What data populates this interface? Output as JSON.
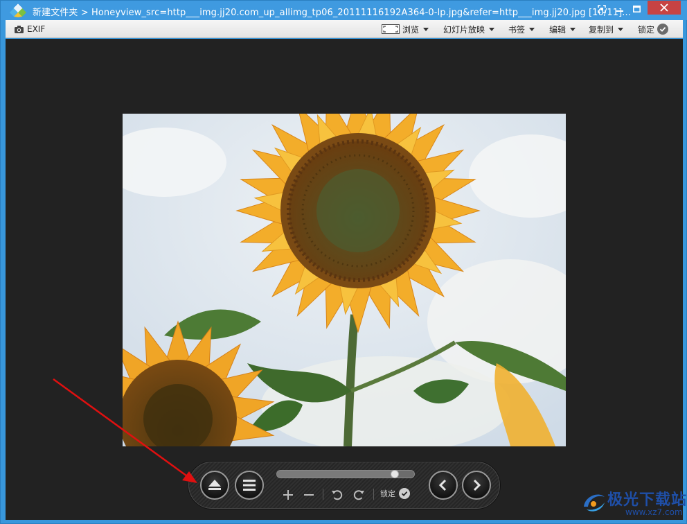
{
  "window": {
    "title": "新建文件夹 > Honeyview_src=http___img.jj20.com_up_allimg_tp06_20111116192A364-0-lp.jpg&refer=http___img.jj20.jpg [10/11]...",
    "icons": {
      "app": "honeyview-logo-icon",
      "fullscreen": "fullscreen-icon",
      "minimize": "minimize-icon",
      "maximize": "maximize-icon",
      "close": "close-icon"
    }
  },
  "toolbar": {
    "exif_label": "EXIF",
    "browse_label": "浏览",
    "slideshow_label": "幻灯片放映",
    "bookmark_label": "书签",
    "edit_label": "编辑",
    "copy_to_label": "复制到",
    "lock_label": "锁定",
    "icons": {
      "exif": "camera-icon",
      "browse": "frame-icon",
      "lock": "check-circle-icon",
      "dropdown": "caret-down-icon"
    }
  },
  "viewer": {
    "image_subject": "sunflower photo",
    "background_color": "#222222"
  },
  "controlbar": {
    "lock_label": "锁定",
    "slider_position": 0.87,
    "icons": {
      "eject": "eject-icon",
      "menu": "menu-icon",
      "zoom_in": "plus-icon",
      "zoom_out": "minus-icon",
      "rotate_left": "rotate-left-icon",
      "rotate_right": "rotate-right-icon",
      "lock": "check-circle-icon",
      "prev": "chevron-left-icon",
      "next": "chevron-right-icon"
    }
  },
  "annotation": {
    "arrow_color": "#e01010"
  },
  "watermark": {
    "title": "极光下载站",
    "url": "www.xz7.com"
  },
  "colors": {
    "titlebar": "#3f9ae0",
    "close_button": "#c74343",
    "toolbar": "#ececec"
  }
}
